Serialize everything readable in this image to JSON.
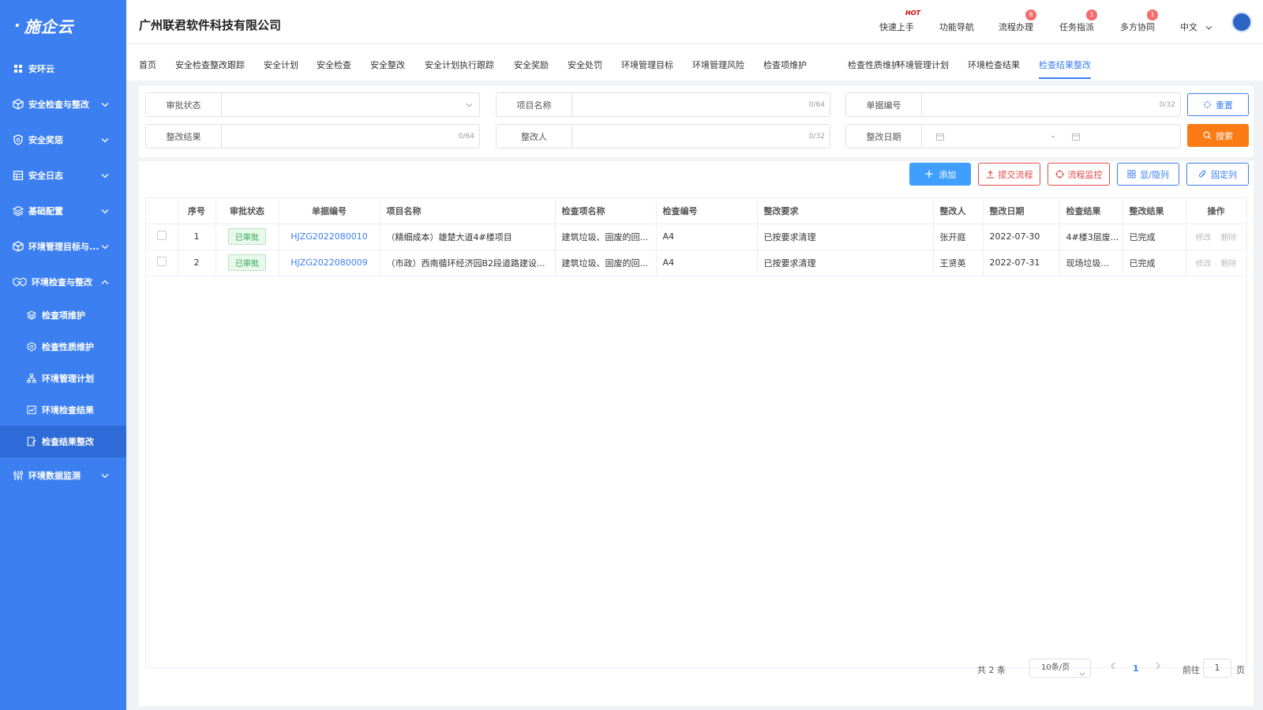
{
  "sidebar": {
    "logo": "施企云",
    "items": [
      {
        "label": "安环云",
        "icon": "grid-icon"
      },
      {
        "label": "安全检查与整改",
        "icon": "cube-icon"
      },
      {
        "label": "安全奖惩",
        "icon": "shield-icon"
      },
      {
        "label": "安全日志",
        "icon": "calendar-icon"
      },
      {
        "label": "基础配置",
        "icon": "layers-icon"
      },
      {
        "label": "环境管理目标与...",
        "icon": "cube-icon"
      },
      {
        "label": "环境检查与整改",
        "icon": "handshake-icon"
      }
    ],
    "subitems": [
      {
        "label": "检查项维护",
        "icon": "layers-icon"
      },
      {
        "label": "检查性质维护",
        "icon": "hexagon-icon"
      },
      {
        "label": "环境管理计划",
        "icon": "sitemap-icon"
      },
      {
        "label": "环境检查结果",
        "icon": "chart-icon"
      },
      {
        "label": "检查结果整改",
        "icon": "edit-doc-icon"
      }
    ],
    "bottom_item": {
      "label": "环境数据监测",
      "icon": "sliders-icon"
    }
  },
  "header": {
    "company": "广州联君软件科技有限公司",
    "nav": [
      {
        "label": "快速上手",
        "badge": "HOT"
      },
      {
        "label": "功能导航",
        "badge": ""
      },
      {
        "label": "流程办理",
        "badge": "8"
      },
      {
        "label": "任务指派",
        "badge": "1"
      },
      {
        "label": "多方协同",
        "badge": "1"
      }
    ],
    "language": "中文"
  },
  "tabs": [
    "首页",
    "安全检查整改跟踪",
    "安全计划",
    "安全检查",
    "安全整改",
    "安全计划执行跟踪",
    "安全奖励",
    "安全处罚",
    "环境管理目标",
    "环境管理风险",
    "检查项维护",
    "检查性质维护",
    "环境管理计划",
    "环境检查结果",
    "检查结果整改"
  ],
  "filters": {
    "approval_status": {
      "label": "审批状态"
    },
    "project_name": {
      "label": "项目名称",
      "count": "0/64"
    },
    "doc_no": {
      "label": "单据编号",
      "count": "0/32"
    },
    "rectify_result": {
      "label": "整改结果",
      "count": "0/64"
    },
    "rectifier": {
      "label": "整改人",
      "count": "0/32"
    },
    "rectify_date": {
      "label": "整改日期",
      "separator": "-"
    },
    "reset": "重置",
    "search": "搜索"
  },
  "toolbar": {
    "add": "添加",
    "submit_flow": "提交流程",
    "flow_monitor": "流程监控",
    "show_hide": "显/隐列",
    "fix_col": "固定列"
  },
  "table": {
    "headers": [
      "序号",
      "审批状态",
      "单据编号",
      "项目名称",
      "检查项名称",
      "检查编号",
      "整改要求",
      "整改人",
      "整改日期",
      "检查结果",
      "整改结果",
      "操作"
    ],
    "rows": [
      {
        "index": "1",
        "status": "已审批",
        "doc_no": "HJZG2022080010",
        "project": "（精细成本）雄楚大道4#楼项目",
        "item": "建筑垃圾、固废的回...",
        "check_no": "A4",
        "req": "已按要求清理",
        "person": "张开庭",
        "date": "2022-07-30",
        "check_result": "4#楼3层废...",
        "rect_result": "已完成",
        "edit": "修改",
        "delete": "删除"
      },
      {
        "index": "2",
        "status": "已审批",
        "doc_no": "HJZG2022080009",
        "project": "（市政）西南循环经济园B2段道路建设...",
        "item": "建筑垃圾、固废的回...",
        "check_no": "A4",
        "req": "已按要求清理",
        "person": "王贤英",
        "date": "2022-07-31",
        "check_result": "现场垃圾...",
        "rect_result": "已完成",
        "edit": "修改",
        "delete": "删除"
      }
    ]
  },
  "pagination": {
    "total": "共 2 条",
    "page_size": "10条/页",
    "current": "1",
    "goto_prefix": "前往",
    "goto_value": "1",
    "goto_suffix": "页"
  },
  "colors": {
    "primary": "#3b7ff0",
    "sidebar": "#3b7ff0",
    "search": "#fa7a14",
    "danger": "#e04b4b",
    "success": "#2ba34a"
  }
}
